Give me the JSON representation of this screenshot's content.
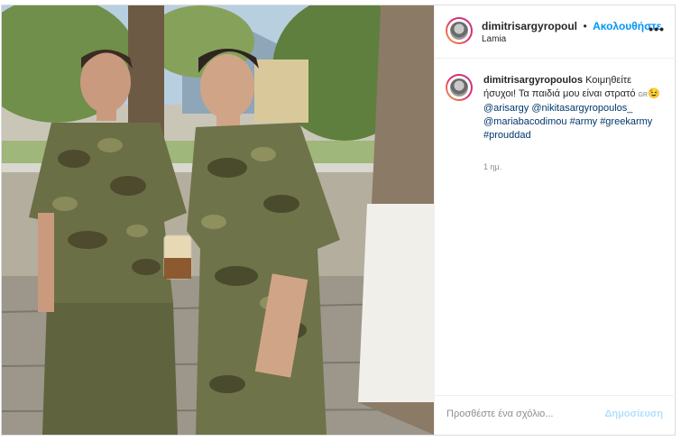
{
  "post": {
    "username": "dimitrisargyropoul",
    "separator": "•",
    "follow_label": "Ακολουθήστε",
    "location": "Lamia",
    "more_icon": "more-options-icon",
    "caption": {
      "username": "dimitrisargyropoulos",
      "text": "Κοιμηθείτε ήσυχοι! Τα παιδιά μου είναι στρατό",
      "flag": "GR",
      "emoji": "😉",
      "mentions": [
        "@arisargy",
        "@nikitasargyropoulos_",
        "@mariabacodimou"
      ],
      "hashtags": [
        "#army",
        "#greekarmy",
        "#prouddad"
      ]
    },
    "timestamp": "1 ημ."
  },
  "comment_box": {
    "placeholder": "Προσθέστε ένα σχόλιο...",
    "post_label": "Δημοσίευση"
  }
}
